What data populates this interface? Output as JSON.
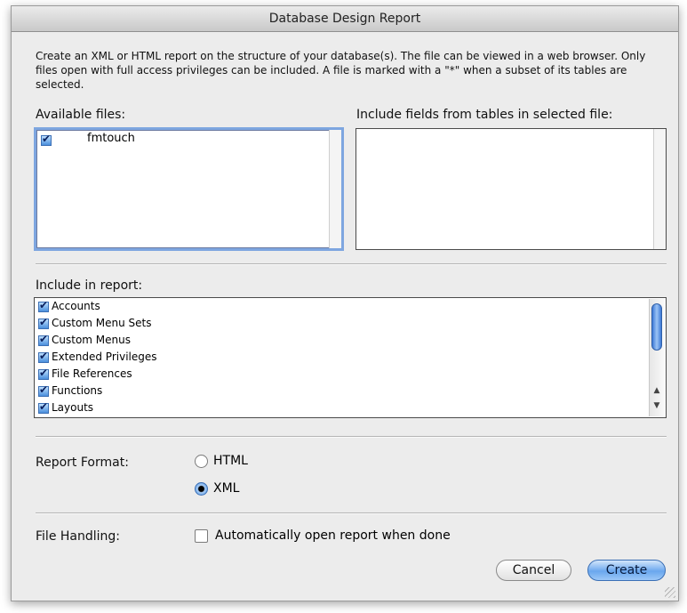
{
  "window": {
    "title": "Database Design Report"
  },
  "description": "Create an XML or HTML report on the structure of your database(s). The file can be viewed in a web browser. Only files open with full access privileges can be included. A file is marked with a \"*\" when a subset of its tables are selected.",
  "available_files": {
    "label": "Available files:",
    "items": [
      {
        "name": "fmtouch",
        "checked": true
      }
    ]
  },
  "tables": {
    "label": "Include fields from tables in selected file:"
  },
  "include": {
    "label": "Include in report:",
    "items": [
      {
        "label": "Accounts",
        "checked": true
      },
      {
        "label": "Custom Menu Sets",
        "checked": true
      },
      {
        "label": "Custom Menus",
        "checked": true
      },
      {
        "label": "Extended Privileges",
        "checked": true
      },
      {
        "label": "File References",
        "checked": true
      },
      {
        "label": "Functions",
        "checked": true
      },
      {
        "label": "Layouts",
        "checked": true
      }
    ]
  },
  "format": {
    "label": "Report Format:",
    "options": [
      {
        "label": "HTML",
        "selected": false
      },
      {
        "label": "XML",
        "selected": true
      }
    ]
  },
  "file_handling": {
    "label": "File Handling:",
    "auto_open_label": "Automatically open report when done",
    "auto_open_checked": false
  },
  "buttons": {
    "cancel": "Cancel",
    "create": "Create"
  }
}
